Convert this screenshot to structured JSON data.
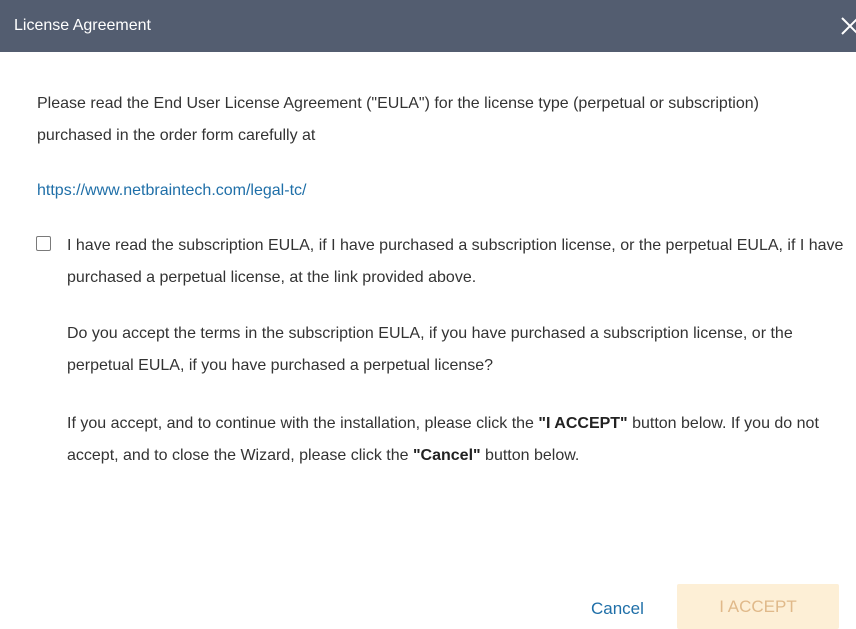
{
  "dialog": {
    "title": "License Agreement",
    "intro_text": "Please read the End User License Agreement (\"EULA\") for the license type (perpetual or subscription) purchased in the order form carefully at",
    "link": "https://www.netbraintech.com/legal-tc/",
    "checkbox": {
      "checked": false,
      "label": "I have read the subscription EULA, if I have purchased a subscription license, or the perpetual EULA, if I have purchased a perpetual license, at the link provided above."
    },
    "question_text": "Do you accept the terms in the subscription EULA, if you have purchased a subscription license, or the perpetual EULA, if you have purchased a perpetual license?",
    "instruction": {
      "part1": "If you accept, and to continue with the installation, please click the ",
      "accept_ref": "\"I ACCEPT\"",
      "part2": " button below. If you do not accept, and to close the Wizard, please click the ",
      "cancel_ref": "\"Cancel\"",
      "part3": " button below."
    },
    "buttons": {
      "cancel": "Cancel",
      "accept": "I ACCEPT",
      "accept_enabled": false
    },
    "icons": {
      "close": "close-icon",
      "checkbox": "checkbox-icon"
    },
    "colors": {
      "titlebar_bg": "#535d70",
      "link": "#1f6fa8",
      "accept_bg_disabled": "#fdefd6",
      "accept_text_disabled": "#e0b98a"
    }
  }
}
